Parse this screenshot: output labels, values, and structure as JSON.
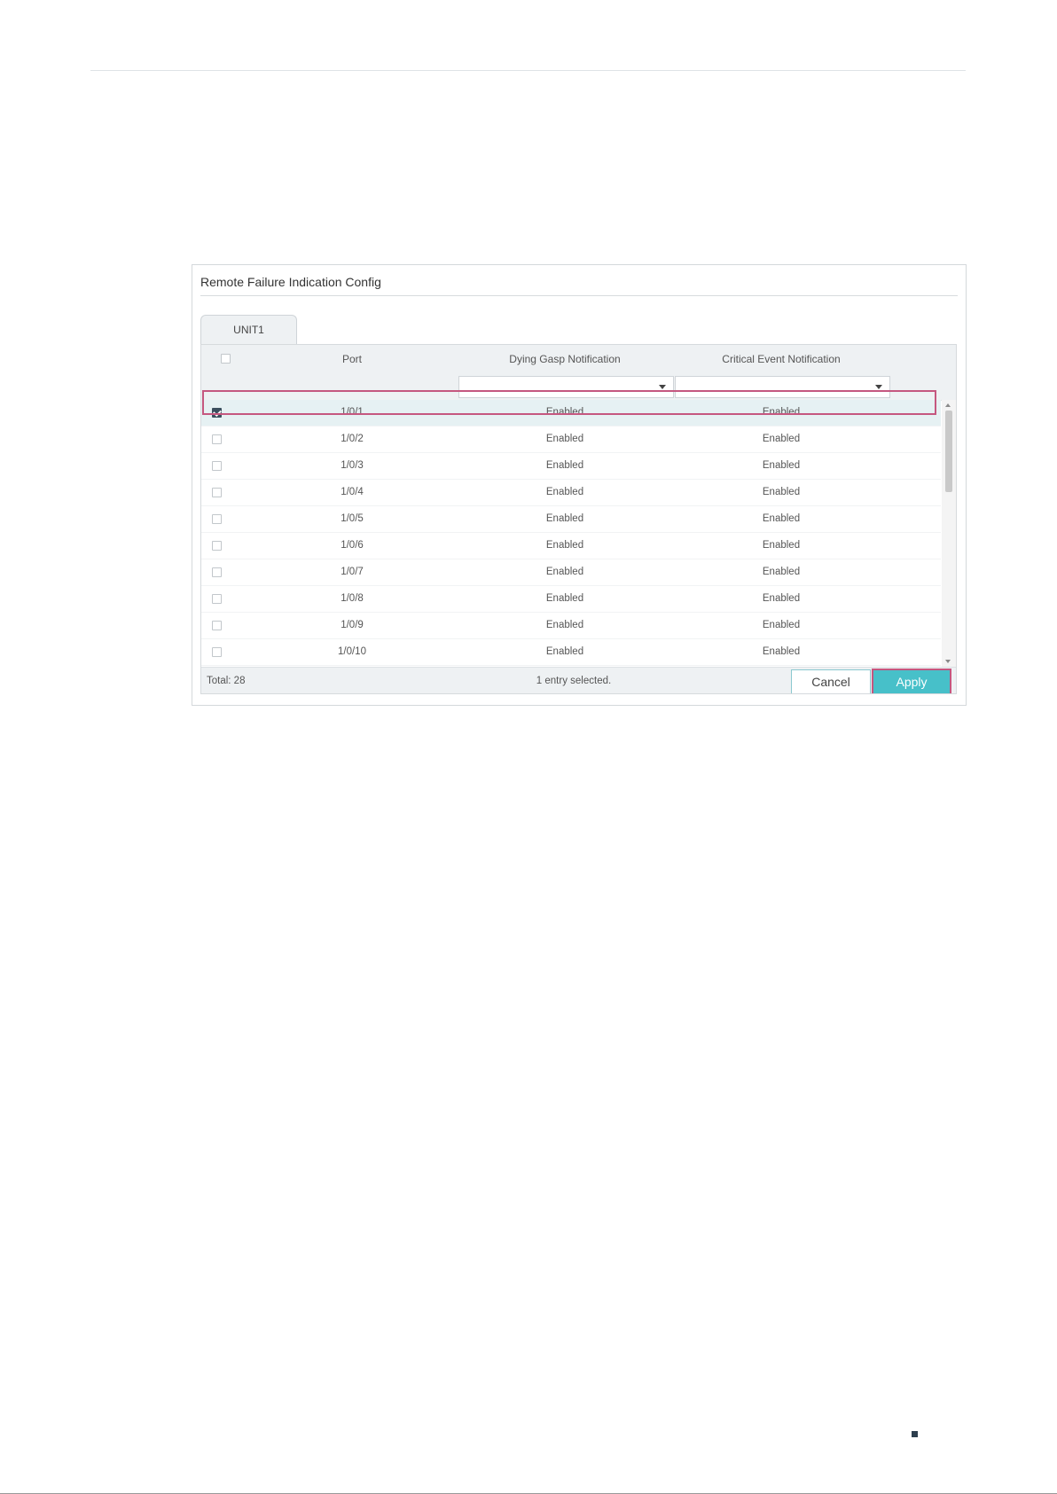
{
  "panel": {
    "title": "Remote Failure Indication Config",
    "tab_label": "UNIT1"
  },
  "table": {
    "headers": {
      "port": "Port",
      "dying_gasp": "Dying Gasp Notification",
      "critical_event": "Critical Event Notification"
    },
    "filters": {
      "dying_gasp_value": "",
      "critical_event_value": ""
    },
    "rows": [
      {
        "port": "1/0/1",
        "dying_gasp": "Enabled",
        "critical_event": "Enabled",
        "checked": true
      },
      {
        "port": "1/0/2",
        "dying_gasp": "Enabled",
        "critical_event": "Enabled",
        "checked": false
      },
      {
        "port": "1/0/3",
        "dying_gasp": "Enabled",
        "critical_event": "Enabled",
        "checked": false
      },
      {
        "port": "1/0/4",
        "dying_gasp": "Enabled",
        "critical_event": "Enabled",
        "checked": false
      },
      {
        "port": "1/0/5",
        "dying_gasp": "Enabled",
        "critical_event": "Enabled",
        "checked": false
      },
      {
        "port": "1/0/6",
        "dying_gasp": "Enabled",
        "critical_event": "Enabled",
        "checked": false
      },
      {
        "port": "1/0/7",
        "dying_gasp": "Enabled",
        "critical_event": "Enabled",
        "checked": false
      },
      {
        "port": "1/0/8",
        "dying_gasp": "Enabled",
        "critical_event": "Enabled",
        "checked": false
      },
      {
        "port": "1/0/9",
        "dying_gasp": "Enabled",
        "critical_event": "Enabled",
        "checked": false
      },
      {
        "port": "1/0/10",
        "dying_gasp": "Enabled",
        "critical_event": "Enabled",
        "checked": false
      }
    ]
  },
  "footer": {
    "total": "Total: 28",
    "selected": "1 entry selected.",
    "cancel_label": "Cancel",
    "apply_label": "Apply"
  },
  "colors": {
    "apply_button": "#47c0c9",
    "highlight_border": "#c5577f",
    "selected_row": "#e6f1f3",
    "checkbox_checked": "#3b4f5e"
  }
}
